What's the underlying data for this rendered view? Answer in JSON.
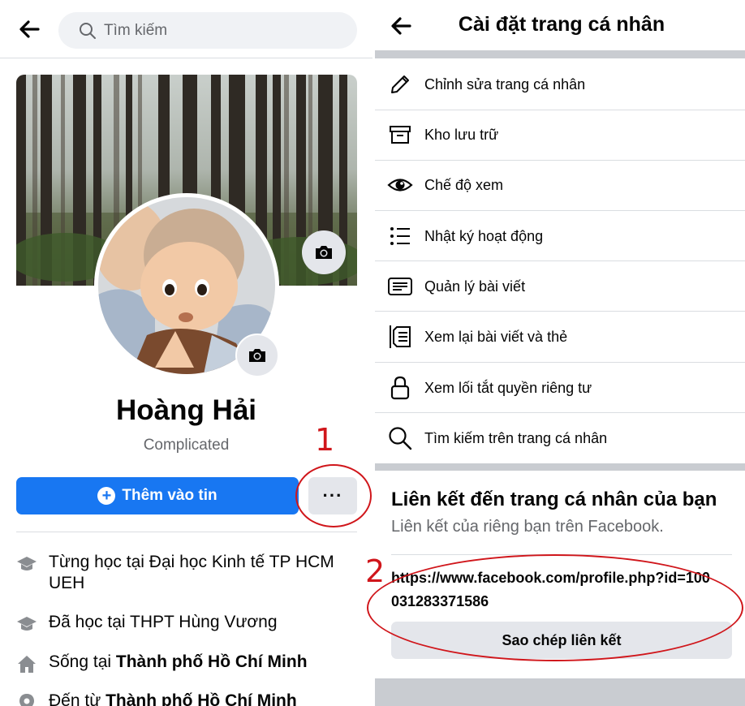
{
  "left": {
    "search": {
      "placeholder": "Tìm kiếm",
      "icon": "search-icon"
    },
    "profile": {
      "name": "Hoàng Hải",
      "bio": "Complicated"
    },
    "annotation_1": "1",
    "actions": {
      "add_story": "Thêm vào tin",
      "more": "···"
    },
    "info": [
      {
        "icon": "graduation-cap-icon",
        "prefix": "Từng học tại Đại học Kinh tế TP HCM UEH",
        "bold": ""
      },
      {
        "icon": "graduation-cap-icon",
        "prefix": "Đã học tại THPT Hùng Vương",
        "bold": ""
      },
      {
        "icon": "home-icon",
        "prefix": "Sống tại ",
        "bold": "Thành phố Hồ Chí Minh"
      },
      {
        "icon": "location-pin-icon",
        "prefix": "Đến từ ",
        "bold": "Thành phố Hồ Chí Minh"
      }
    ]
  },
  "right": {
    "title": "Cài đặt trang cá nhân",
    "menu": [
      {
        "label": "Chỉnh sửa trang cá nhân",
        "icon": "pencil-icon"
      },
      {
        "label": "Kho lưu trữ",
        "icon": "archive-box-icon"
      },
      {
        "label": "Chế độ xem",
        "icon": "eye-icon"
      },
      {
        "label": "Nhật ký hoạt động",
        "icon": "list-icon"
      },
      {
        "label": "Quản lý bài viết",
        "icon": "post-icon"
      },
      {
        "label": "Xem lại bài viết và thẻ",
        "icon": "review-tags-icon"
      },
      {
        "label": "Xem lối tắt quyền riêng tư",
        "icon": "lock-icon"
      },
      {
        "label": "Tìm kiếm trên trang cá nhân",
        "icon": "search-icon"
      }
    ],
    "link": {
      "title": "Liên kết đến trang cá nhân của bạn",
      "subtitle": "Liên kết của riêng bạn trên Facebook.",
      "url": "https://www.facebook.com/profile.php?id=100031283371586",
      "copy_label": "Sao chép liên kết"
    },
    "annotation_2": "2"
  },
  "colors": {
    "accent": "#1877f2",
    "annotation": "#d0161b",
    "band": "#c9ccd1",
    "button_gray": "#e4e6eb"
  }
}
